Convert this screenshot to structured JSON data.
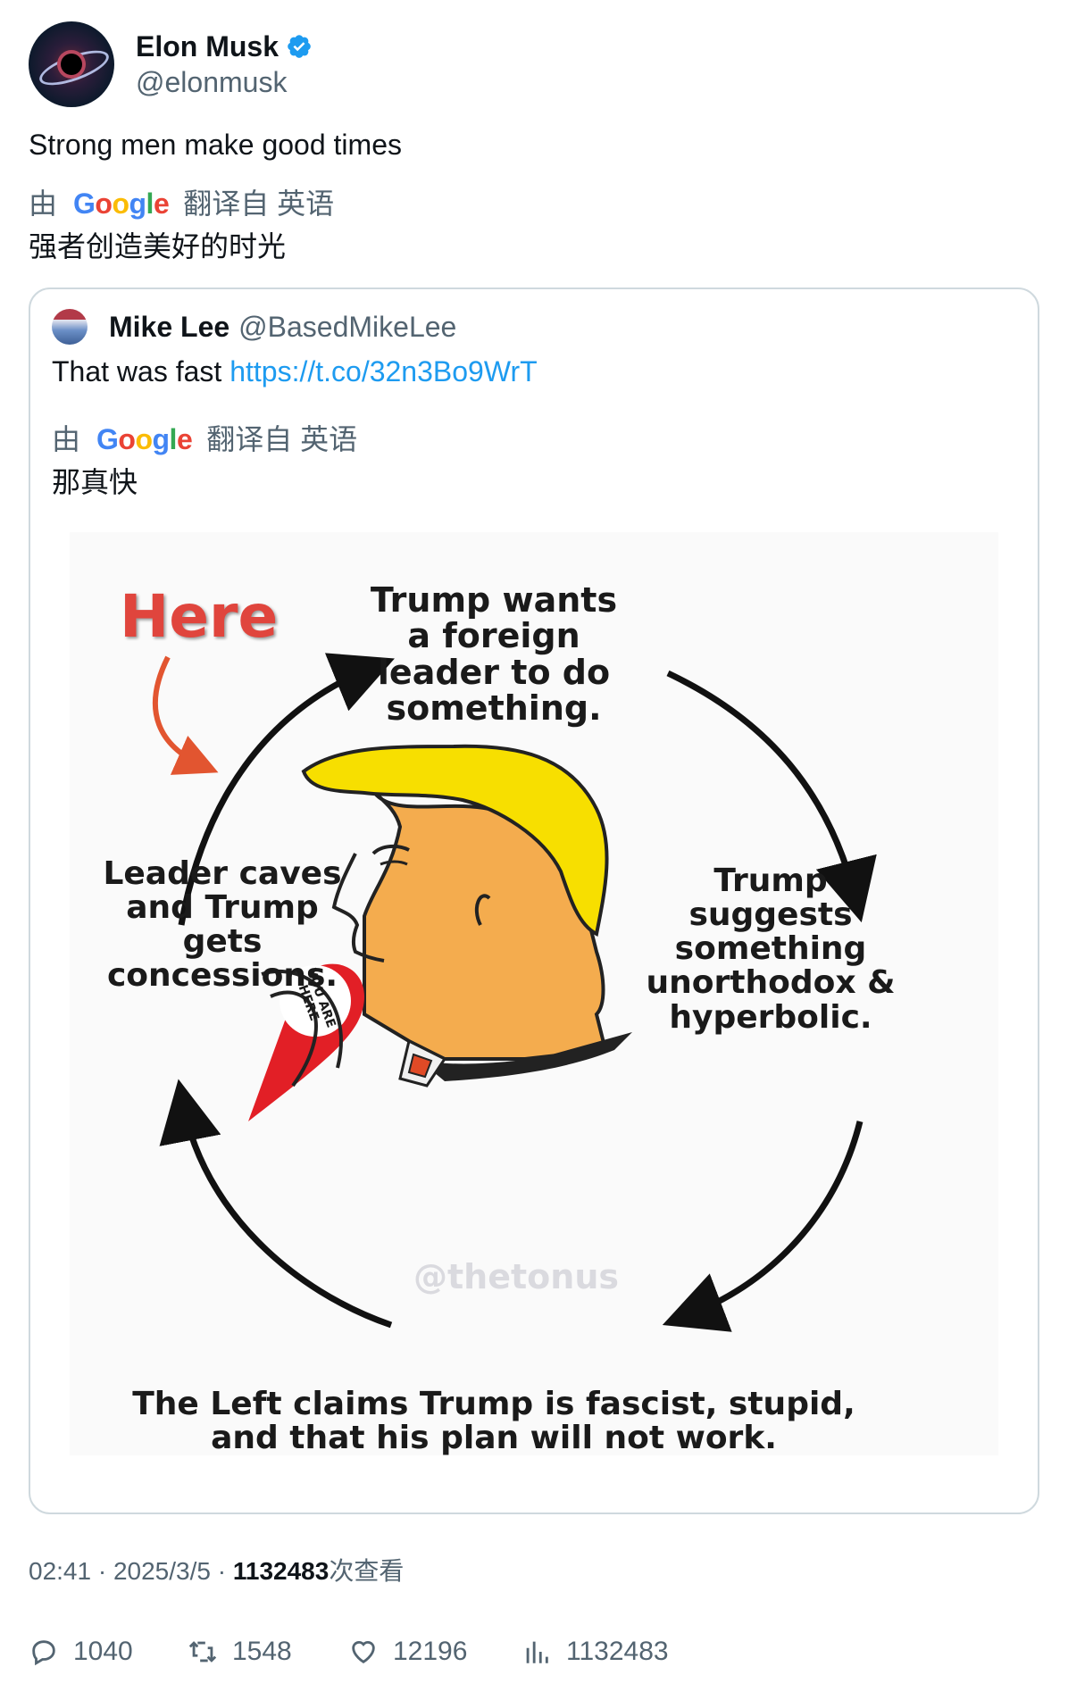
{
  "tweet": {
    "author_name": "Elon Musk",
    "author_handle": "@elonmusk",
    "text": "Strong men make good times",
    "translate_by": "由",
    "translate_brand": "Google",
    "translate_from": "翻译自 英语",
    "translation": "强者创造美好的时光",
    "time": "02:41",
    "date": "2025/3/5",
    "views_count": "1132483",
    "views_label": "次查看"
  },
  "quote": {
    "author_name": "Mike Lee",
    "author_handle": "@BasedMikeLee",
    "text": "That was fast",
    "link": "https://t.co/32n3Bo9WrT",
    "translate_by": "由",
    "translate_brand": "Google",
    "translate_from": "翻译自 英语",
    "translation": "那真快"
  },
  "meme": {
    "here_label": "Here",
    "top_label": "Trump wants a foreign leader to do something.",
    "right_label": "Trump suggests something unorthodox & hyperbolic.",
    "bottom_label": "The Left claims Trump is fascist, stupid, and that his plan will not work.",
    "left_label": "Leader caves and Trump gets concessions.",
    "pin_text": "YOU ARE HERE",
    "watermark": "@thetonus"
  },
  "actions": {
    "replies": "1040",
    "retweets": "1548",
    "likes": "12196",
    "views": "1132483"
  },
  "icons": {
    "verified": "verified-badge-icon",
    "reply": "reply-icon",
    "retweet": "retweet-icon",
    "like": "heart-icon",
    "views": "views-icon"
  },
  "colors": {
    "link": "#1d9bf0",
    "verified": "#1d9bf0",
    "secondary_text": "#536471",
    "border": "#cfd9de",
    "here_red": "#e0453d",
    "hair_yellow": "#f7df00",
    "skin": "#f4ac4e"
  }
}
